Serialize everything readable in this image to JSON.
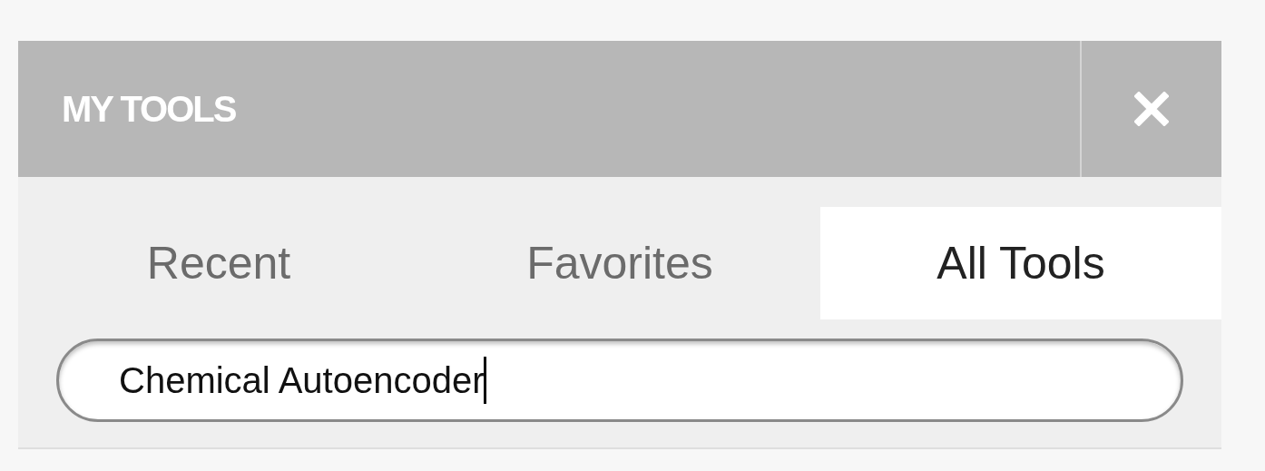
{
  "panel": {
    "title": "MY TOOLS"
  },
  "tabs": [
    {
      "label": "Recent",
      "selected": false
    },
    {
      "label": "Favorites",
      "selected": false
    },
    {
      "label": "All Tools",
      "selected": true
    }
  ],
  "search": {
    "value": "Chemical Autoencoder",
    "focused": true
  }
}
